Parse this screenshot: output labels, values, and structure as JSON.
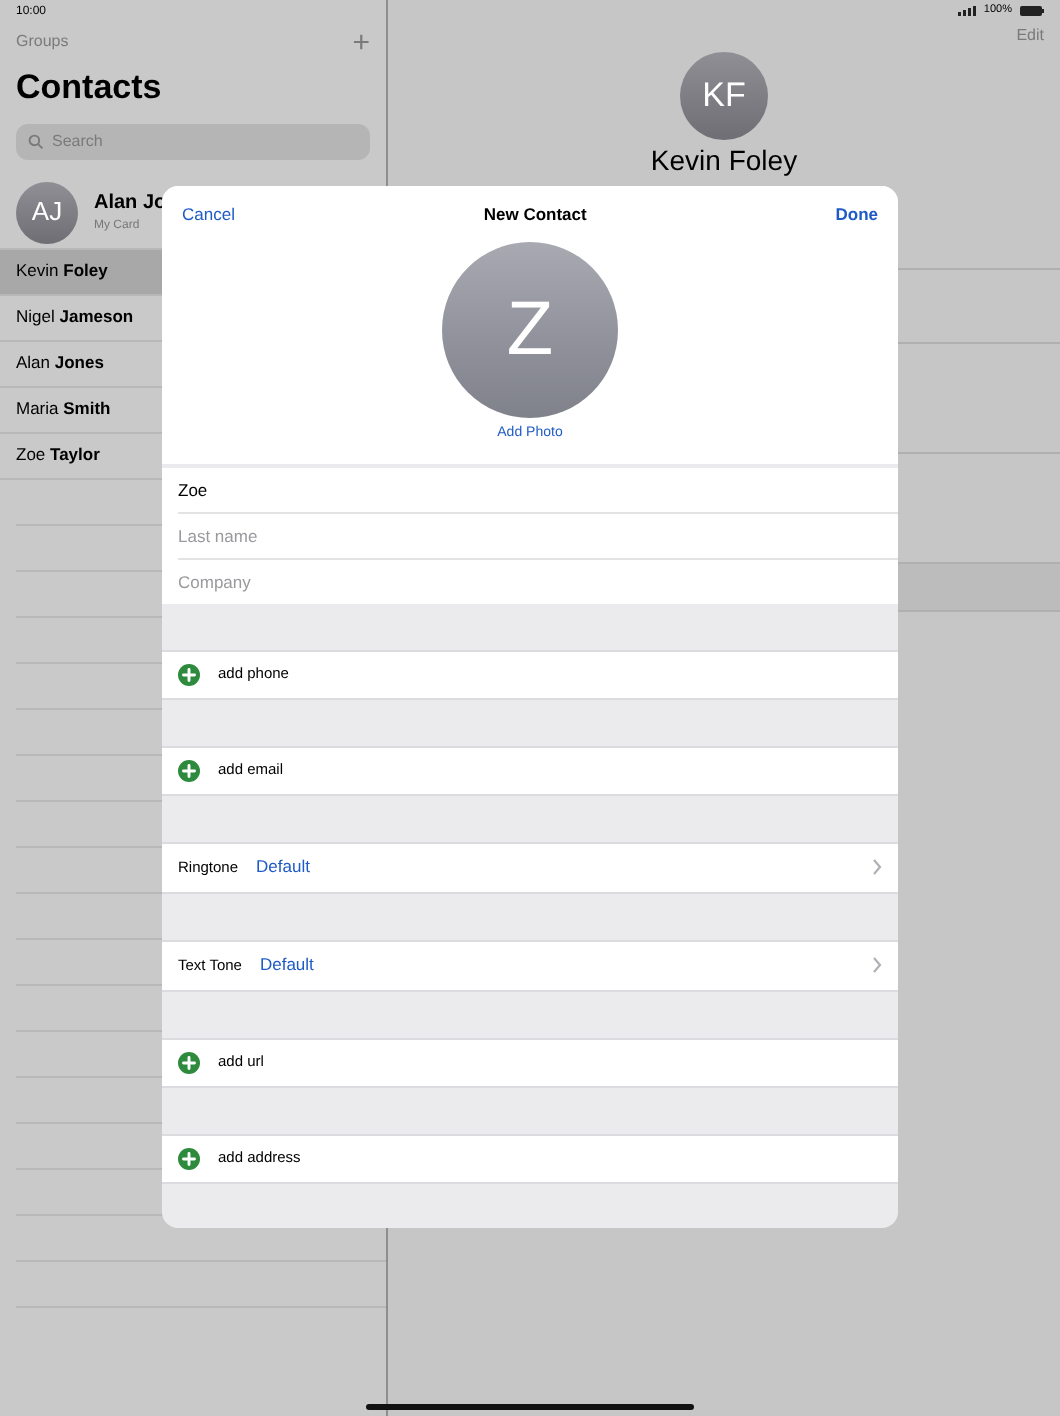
{
  "status_bar": {
    "time": "10:00",
    "battery": "100%"
  },
  "sidebar": {
    "groups_button": "Groups",
    "add_button": "+",
    "title": "Contacts",
    "search": {
      "placeholder": "Search"
    },
    "my_card": {
      "initials": "AJ",
      "name": "Alan Jo",
      "subtitle": "My Card"
    },
    "contacts": [
      {
        "name": "Kevin **Foley**",
        "selected": true
      },
      {
        "name": "Nigel **Jameson**",
        "selected": false
      },
      {
        "name": "Alan **Jones**",
        "selected": false
      },
      {
        "name": "Maria **Smith**",
        "selected": false
      },
      {
        "name": "Zoe **Taylor**",
        "selected": false
      }
    ]
  },
  "detail": {
    "edit_button": "Edit",
    "initials": "KF",
    "name": "Kevin Foley"
  },
  "modal": {
    "cancel": "Cancel",
    "title": "New Contact",
    "done": "Done",
    "avatar_letter": "Z",
    "add_photo": "Add Photo",
    "fields": [
      {
        "value": "Zoe"
      },
      {
        "placeholder": "Last name"
      },
      {
        "placeholder": "Company"
      }
    ],
    "sections": [
      {
        "kind": "add",
        "label": "add phone"
      },
      {
        "kind": "add",
        "label": "add email"
      },
      {
        "kind": "tone",
        "label": "Ringtone",
        "value": "Default"
      },
      {
        "kind": "tone",
        "label": "Text Tone",
        "value": "Default"
      },
      {
        "kind": "add",
        "label": "add url"
      },
      {
        "kind": "add",
        "label": "add address"
      }
    ]
  }
}
